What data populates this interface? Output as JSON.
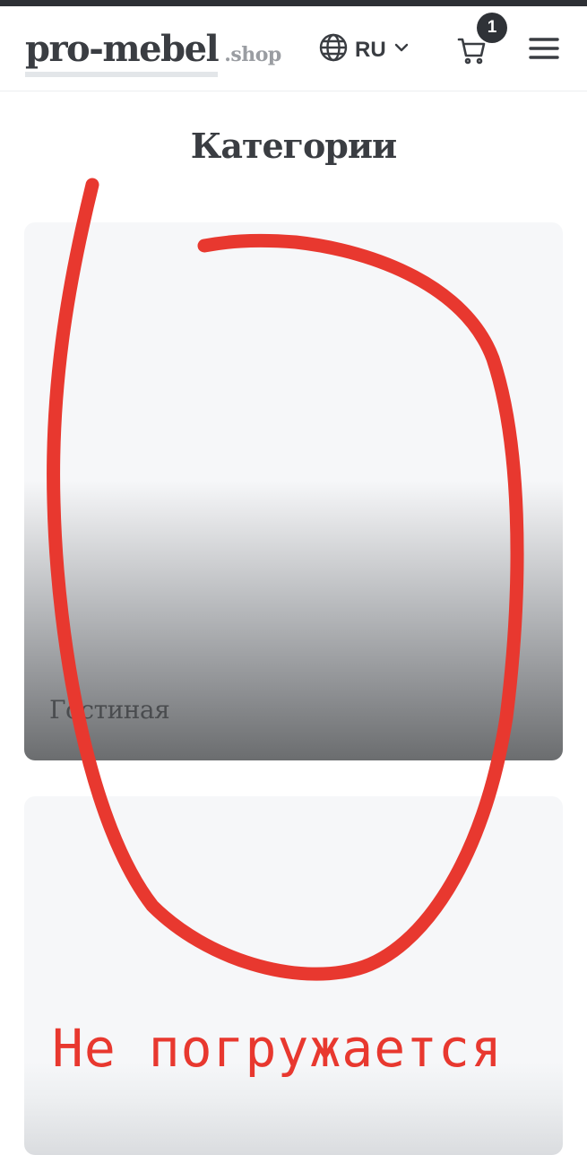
{
  "header": {
    "logo_main": "pro-mebel",
    "logo_sub": ".shop",
    "language": "RU",
    "cart_count": "1"
  },
  "icons": {
    "globe": "globe-icon",
    "chevron": "chevron-down-icon",
    "cart": "cart-icon",
    "menu": "hamburger-menu-icon"
  },
  "section": {
    "title": "Категории"
  },
  "categories": [
    {
      "label": "Гостиная"
    },
    {
      "label": ""
    }
  ],
  "annotation": {
    "text": "Не погружается",
    "color": "#e8382f"
  },
  "colors": {
    "dark": "#2d3035",
    "text": "#3a3d42",
    "muted": "#9a9da2",
    "card_bg": "#f6f7f9"
  }
}
